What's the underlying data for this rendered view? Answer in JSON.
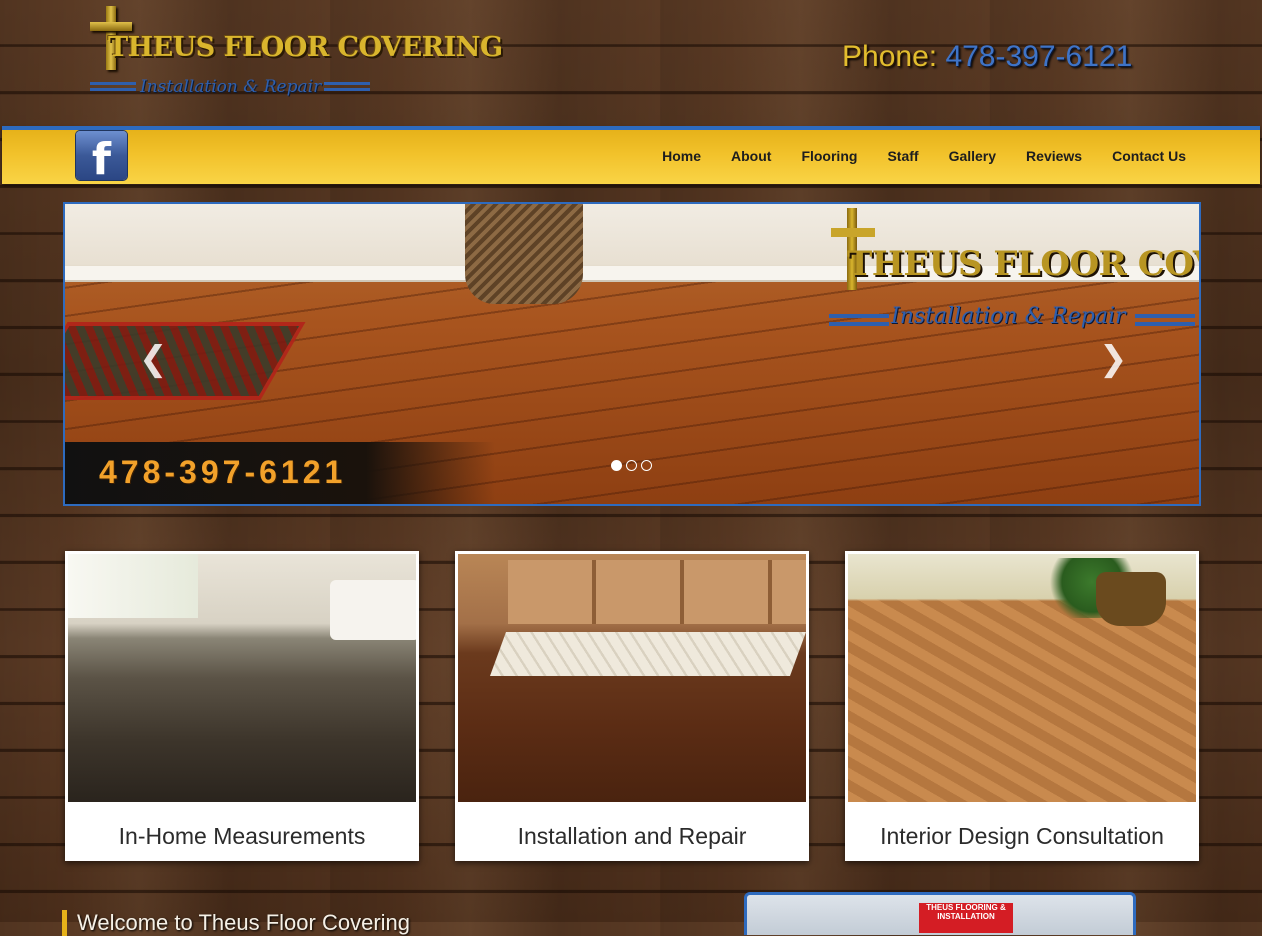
{
  "header": {
    "logo_title": "THEUS FLOOR COVERING",
    "logo_subtitle": "Installation & Repair",
    "phone_label": "Phone:",
    "phone_number": "478-397-6121"
  },
  "nav": {
    "facebook_icon": "facebook-icon",
    "items": [
      {
        "label": "Home"
      },
      {
        "label": "About"
      },
      {
        "label": "Flooring"
      },
      {
        "label": "Staff"
      },
      {
        "label": "Gallery"
      },
      {
        "label": "Reviews"
      },
      {
        "label": "Contact Us"
      }
    ]
  },
  "slider": {
    "logo_title": "THEUS FLOOR COVERING",
    "logo_subtitle": "Installation & Repair",
    "phone": "478-397-6121",
    "prev_icon": "chevron-left-icon",
    "next_icon": "chevron-right-icon",
    "slide_count": 3,
    "active_slide": 1
  },
  "cards": [
    {
      "title": "In-Home Measurements"
    },
    {
      "title": "Installation and Repair"
    },
    {
      "title": "Interior Design Consultation"
    }
  ],
  "welcome": {
    "heading": "Welcome to Theus Floor Covering"
  },
  "truck_sign": "THEUS FLOORING & INSTALLATION",
  "colors": {
    "accent_blue": "#2e6bbf",
    "nav_gold": "#f2c22b",
    "logo_gold": "#d9b52d"
  }
}
